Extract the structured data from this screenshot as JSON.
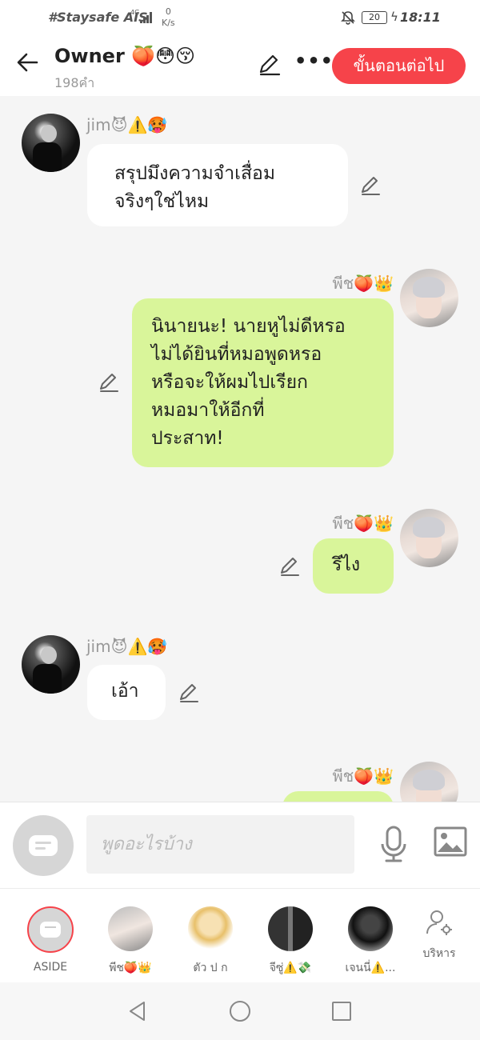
{
  "status_bar": {
    "carrier": "#Staysafe AIS",
    "network": "4G",
    "speed_value": "0",
    "speed_unit": "K/s",
    "battery": "20",
    "time": "18:11"
  },
  "header": {
    "title": "Owner 🍑😳😚",
    "word_count": "198คำ",
    "more_label": "•••",
    "next_button": "ขั้นตอนต่อไป"
  },
  "messages": [
    {
      "sender": "jim😈⚠️🥵",
      "side": "left",
      "text_lines": [
        "สรุปมึงความจำเสื่อม",
        "จริงๆใช่ไหม"
      ]
    },
    {
      "sender": "พีช🍑👑",
      "side": "right",
      "text_lines": [
        "นินายนะ! นายหูไม่ดีหรอ",
        "ไม่ได้ยินที่หมอพูดหรอ",
        "หรือจะให้ผมไปเรียก",
        "หมอมาให้อีกที่",
        "ประสาท!"
      ]
    },
    {
      "sender": "พีช🍑👑",
      "side": "right",
      "text_lines": [
        "รึไง"
      ]
    },
    {
      "sender": "jim😈⚠️🥵",
      "side": "left",
      "text_lines": [
        "เอ้า"
      ]
    },
    {
      "sender": "พีช🍑👑",
      "side": "right",
      "text_lines": [
        ""
      ]
    }
  ],
  "input": {
    "placeholder": "พูดอะไรบ้าง"
  },
  "characters": [
    {
      "label": "ASIDE"
    },
    {
      "label": "พีช🍑👑"
    },
    {
      "label": "ตัว ป ก"
    },
    {
      "label": "จีซู่⚠️💸"
    },
    {
      "label": "เจนนี่⚠️..."
    }
  ],
  "manage_label": "บริหาร",
  "colors": {
    "accent": "#f6434a",
    "bubble_self": "#d9f59a",
    "bubble_other": "#ffffff",
    "chat_bg": "#f5f5f5"
  }
}
